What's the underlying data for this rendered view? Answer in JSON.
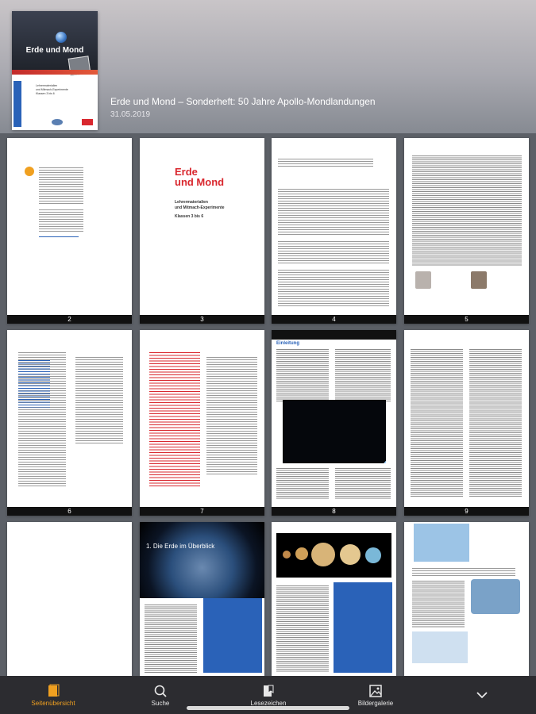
{
  "header": {
    "cover_title": "Erde und Mond",
    "cover_subtitle_lines": [
      "Lehrermaterialien",
      "und Mitmach-Experimente",
      "Klassen 3 bis 6"
    ],
    "issue_title": "Erde und Mond –  Sonderheft: 50 Jahre Apollo-Mondlandungen",
    "issue_date": "31.05.2019"
  },
  "pages": {
    "p3": {
      "title_line1": "Erde",
      "title_line2": "und Mond",
      "sub1": "Lehrermaterialien",
      "sub2": "und Mitmach-Experimente",
      "sub3": "Klassen 3 bis 6"
    },
    "p8": {
      "heading": "Einleitung"
    },
    "p11": {
      "banner": "1. Die Erde im Überblick"
    },
    "numbers": [
      "2",
      "3",
      "4",
      "5",
      "6",
      "7",
      "8",
      "9"
    ]
  },
  "tabbar": {
    "tabs": [
      {
        "label": "Seitenübersicht",
        "icon": "pages-icon",
        "active": true
      },
      {
        "label": "Suche",
        "icon": "search-icon",
        "active": false
      },
      {
        "label": "Lesezeichen",
        "icon": "bookmark-icon",
        "active": false
      },
      {
        "label": "Bildergalerie",
        "icon": "gallery-icon",
        "active": false
      }
    ]
  },
  "colors": {
    "accent": "#f0a020",
    "tabbar": "#2c2c30",
    "brand_red": "#d9272e",
    "brand_blue": "#2a62b8"
  }
}
